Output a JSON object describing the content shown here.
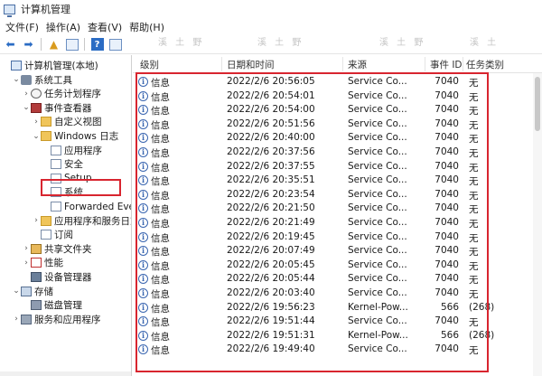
{
  "window": {
    "title": "计算机管理"
  },
  "menu": [
    "文件(F)",
    "操作(A)",
    "查看(V)",
    "帮助(H)"
  ],
  "toolbar": {
    "back_icon": "back-arrow-icon",
    "forward_icon": "forward-arrow-icon",
    "up_icon": "up-folder-icon",
    "show_tree_icon": "show-tree-icon",
    "help_icon": "help-icon",
    "properties_icon": "properties-icon"
  },
  "tree": {
    "items": [
      {
        "label": "计算机管理(本地)",
        "indent": 0,
        "arrow": "",
        "icon": "computer-icon"
      },
      {
        "label": "系统工具",
        "indent": 1,
        "arrow": "⌄",
        "icon": "tools-icon"
      },
      {
        "label": "任务计划程序",
        "indent": 2,
        "arrow": "›",
        "icon": "clock-icon"
      },
      {
        "label": "事件查看器",
        "indent": 2,
        "arrow": "⌄",
        "icon": "event-viewer-icon"
      },
      {
        "label": "自定义视图",
        "indent": 3,
        "arrow": "›",
        "icon": "folder-icon"
      },
      {
        "label": "Windows 日志",
        "indent": 3,
        "arrow": "⌄",
        "icon": "folder-icon"
      },
      {
        "label": "应用程序",
        "indent": 4,
        "arrow": "",
        "icon": "log-icon"
      },
      {
        "label": "安全",
        "indent": 4,
        "arrow": "",
        "icon": "log-icon"
      },
      {
        "label": "Setup",
        "indent": 4,
        "arrow": "",
        "icon": "log-icon"
      },
      {
        "label": "系统",
        "indent": 4,
        "arrow": "",
        "icon": "log-icon"
      },
      {
        "label": "Forwarded Eve",
        "indent": 4,
        "arrow": "",
        "icon": "log-icon"
      },
      {
        "label": "应用程序和服务日志",
        "indent": 3,
        "arrow": "›",
        "icon": "folder-icon"
      },
      {
        "label": "订阅",
        "indent": 3,
        "arrow": "",
        "icon": "log-icon"
      },
      {
        "label": "共享文件夹",
        "indent": 2,
        "arrow": "›",
        "icon": "shared-folder-icon"
      },
      {
        "label": "性能",
        "indent": 2,
        "arrow": "›",
        "icon": "performance-icon"
      },
      {
        "label": "设备管理器",
        "indent": 2,
        "arrow": "",
        "icon": "device-manager-icon"
      },
      {
        "label": "存储",
        "indent": 1,
        "arrow": "⌄",
        "icon": "storage-icon"
      },
      {
        "label": "磁盘管理",
        "indent": 2,
        "arrow": "",
        "icon": "disk-icon"
      },
      {
        "label": "服务和应用程序",
        "indent": 1,
        "arrow": "›",
        "icon": "services-icon"
      }
    ]
  },
  "list": {
    "columns": [
      "级别",
      "日期和时间",
      "来源",
      "事件 ID",
      "任务类别"
    ],
    "rows": [
      {
        "level": "信息",
        "datetime": "2022/2/6 20:56:05",
        "source": "Service Co...",
        "event_id": "7040",
        "category": "无"
      },
      {
        "level": "信息",
        "datetime": "2022/2/6 20:54:01",
        "source": "Service Co...",
        "event_id": "7040",
        "category": "无"
      },
      {
        "level": "信息",
        "datetime": "2022/2/6 20:54:00",
        "source": "Service Co...",
        "event_id": "7040",
        "category": "无"
      },
      {
        "level": "信息",
        "datetime": "2022/2/6 20:51:56",
        "source": "Service Co...",
        "event_id": "7040",
        "category": "无"
      },
      {
        "level": "信息",
        "datetime": "2022/2/6 20:40:00",
        "source": "Service Co...",
        "event_id": "7040",
        "category": "无"
      },
      {
        "level": "信息",
        "datetime": "2022/2/6 20:37:56",
        "source": "Service Co...",
        "event_id": "7040",
        "category": "无"
      },
      {
        "level": "信息",
        "datetime": "2022/2/6 20:37:55",
        "source": "Service Co...",
        "event_id": "7040",
        "category": "无"
      },
      {
        "level": "信息",
        "datetime": "2022/2/6 20:35:51",
        "source": "Service Co...",
        "event_id": "7040",
        "category": "无"
      },
      {
        "level": "信息",
        "datetime": "2022/2/6 20:23:54",
        "source": "Service Co...",
        "event_id": "7040",
        "category": "无"
      },
      {
        "level": "信息",
        "datetime": "2022/2/6 20:21:50",
        "source": "Service Co...",
        "event_id": "7040",
        "category": "无"
      },
      {
        "level": "信息",
        "datetime": "2022/2/6 20:21:49",
        "source": "Service Co...",
        "event_id": "7040",
        "category": "无"
      },
      {
        "level": "信息",
        "datetime": "2022/2/6 20:19:45",
        "source": "Service Co...",
        "event_id": "7040",
        "category": "无"
      },
      {
        "level": "信息",
        "datetime": "2022/2/6 20:07:49",
        "source": "Service Co...",
        "event_id": "7040",
        "category": "无"
      },
      {
        "level": "信息",
        "datetime": "2022/2/6 20:05:45",
        "source": "Service Co...",
        "event_id": "7040",
        "category": "无"
      },
      {
        "level": "信息",
        "datetime": "2022/2/6 20:05:44",
        "source": "Service Co...",
        "event_id": "7040",
        "category": "无"
      },
      {
        "level": "信息",
        "datetime": "2022/2/6 20:03:40",
        "source": "Service Co...",
        "event_id": "7040",
        "category": "无"
      },
      {
        "level": "信息",
        "datetime": "2022/2/6 19:56:23",
        "source": "Kernel-Pow...",
        "event_id": "566",
        "category": "(268)"
      },
      {
        "level": "信息",
        "datetime": "2022/2/6 19:51:44",
        "source": "Service Co...",
        "event_id": "7040",
        "category": "无"
      },
      {
        "level": "信息",
        "datetime": "2022/2/6 19:51:31",
        "source": "Kernel-Pow...",
        "event_id": "566",
        "category": "(268)"
      },
      {
        "level": "信息",
        "datetime": "2022/2/6 19:49:40",
        "source": "Service Co...",
        "event_id": "7040",
        "category": "无"
      }
    ]
  },
  "colors": {
    "highlight_box": "#d8252f",
    "info_icon": "#3a66b0"
  }
}
